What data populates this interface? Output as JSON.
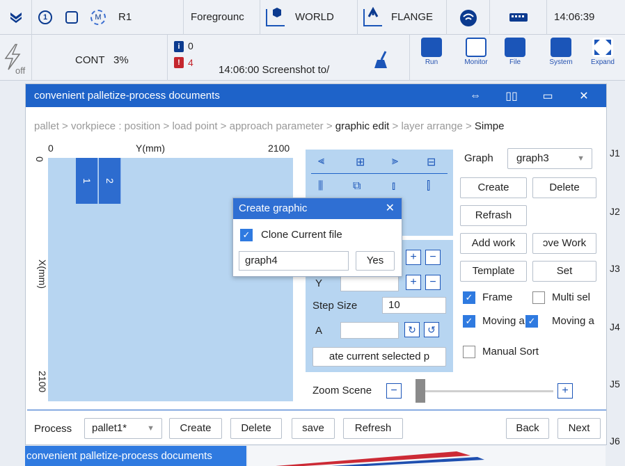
{
  "topbar": {
    "robot": "R1",
    "coord_mode": "Foregrounc",
    "frame_world": "WORLD",
    "frame_flange": "FLANGE",
    "time": "14:06:39"
  },
  "secbar": {
    "power": "off",
    "mode": "CONT",
    "speed": "3%",
    "info_count": "0",
    "error_count": "4",
    "message": "14:06:00 Screenshot to/",
    "tools": [
      "Run",
      "Monitor",
      "File",
      "System",
      "Expand"
    ]
  },
  "window": {
    "title": "convenient palletize-process documents",
    "buttons": [
      "⇔",
      "▯▯",
      "▭",
      "✕"
    ]
  },
  "breadcrumb": {
    "prefix": "pallet > vorkpiece : position > load point > approach parameter > ",
    "current": "graphic edit",
    "suffix": " > layer arrange >  ",
    "last": "Simpe"
  },
  "canvas": {
    "x0": "0",
    "y_label": "Y(mm)",
    "y_max": "2100",
    "x_zero": "0",
    "x_label": "X(mm)",
    "x_max": "2100",
    "blocks": [
      "1",
      "2"
    ]
  },
  "position": {
    "y_label": "Y",
    "step_label": "Step Size",
    "step_value": "10",
    "a_label": "A",
    "update_button": "ate current selected p"
  },
  "zoom": {
    "label": "Zoom Scene",
    "minus": "−",
    "plus": "+"
  },
  "graph": {
    "label": "Graph",
    "selected": "graph3",
    "create": "Create",
    "delete": "Delete",
    "refresh": "Refrash",
    "add_work": "Add work",
    "remove_work": "ɔve Work",
    "template": "Template",
    "set": "Set",
    "frame": "Frame",
    "multi_sel": "Multi sel",
    "moving_a": "Moving a",
    "moving_b": "Moving a",
    "manual_sort": "Manual Sort"
  },
  "dialog": {
    "title": "Create graphic",
    "clone_label": "Clone Current file",
    "name_value": "graph4",
    "yes": "Yes"
  },
  "bottom": {
    "process_label": "Process",
    "process_value": "pallet1*",
    "create": "Create",
    "delete": "Delete",
    "save": "save",
    "refresh": "Refresh",
    "back": "Back",
    "next": "Next"
  },
  "joints": [
    "J1",
    "J2",
    "J3",
    "J4",
    "J5",
    "J6"
  ],
  "taskbar": {
    "label": "convenient palletize-process documents"
  }
}
